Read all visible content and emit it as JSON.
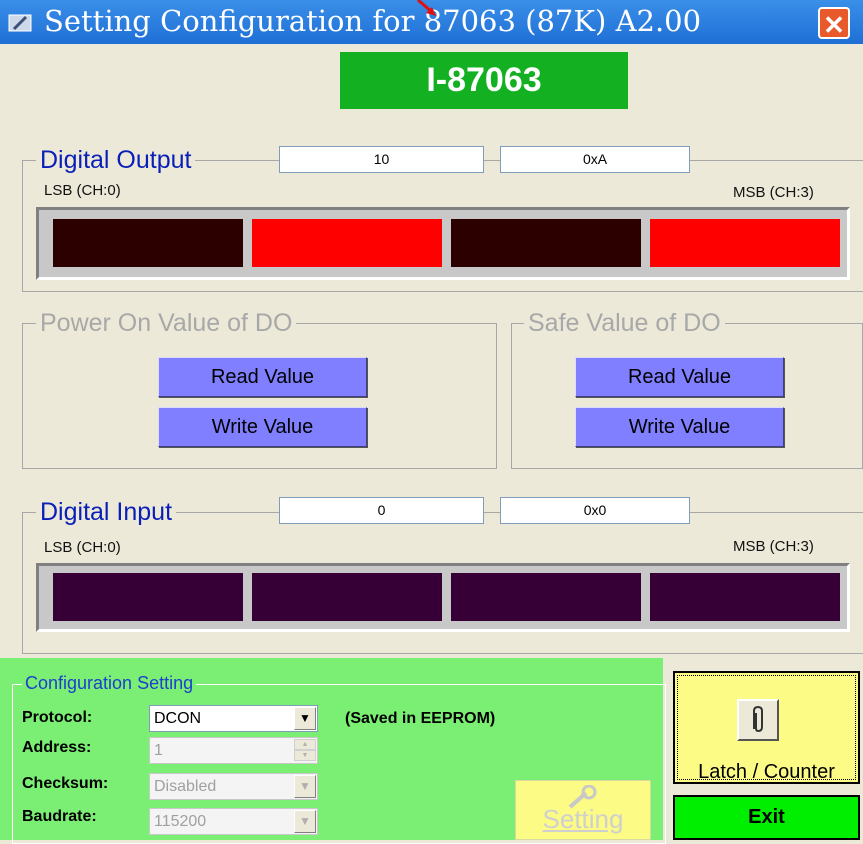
{
  "window": {
    "title": "Setting Configuration for 87063 (87K) A2.00",
    "close_label": "✕"
  },
  "module": {
    "name": "I-87063"
  },
  "digital_output": {
    "title": "Digital Output",
    "value_dec": "10",
    "value_hex": "0xA",
    "lsb_label": "LSB (CH:0)",
    "msb_label": "MSB (CH:3)",
    "channels": [
      {
        "on": false,
        "color": "#2d0000"
      },
      {
        "on": true,
        "color": "#ff0000"
      },
      {
        "on": false,
        "color": "#2d0000"
      },
      {
        "on": true,
        "color": "#ff0000"
      }
    ]
  },
  "power_on_value": {
    "title": "Power On Value of DO",
    "read_label": "Read Value",
    "write_label": "Write Value"
  },
  "safe_value": {
    "title": "Safe Value of DO",
    "read_label": "Read Value",
    "write_label": "Write Value"
  },
  "digital_input": {
    "title": "Digital Input",
    "value_dec": "0",
    "value_hex": "0x0",
    "lsb_label": "LSB (CH:0)",
    "msb_label": "MSB (CH:3)",
    "channels": [
      {
        "on": false,
        "color": "#360036"
      },
      {
        "on": false,
        "color": "#360036"
      },
      {
        "on": false,
        "color": "#360036"
      },
      {
        "on": false,
        "color": "#360036"
      }
    ]
  },
  "config": {
    "title": "Configuration Setting",
    "protocol_label": "Protocol:",
    "protocol_value": "DCON",
    "saved_note": "(Saved in EEPROM)",
    "address_label": "Address:",
    "address_value": "1",
    "checksum_label": "Checksum:",
    "checksum_value": "Disabled",
    "baudrate_label": "Baudrate:",
    "baudrate_value": "115200",
    "setting_label": "Setting"
  },
  "actions": {
    "latch_label": "Latch / Counter",
    "exit_label": "Exit"
  },
  "colors": {
    "title_bar": "#2a7de0",
    "module_badge": "#13b022",
    "config_panel": "#7bee74",
    "accent_blue": "#0a1fb8"
  }
}
